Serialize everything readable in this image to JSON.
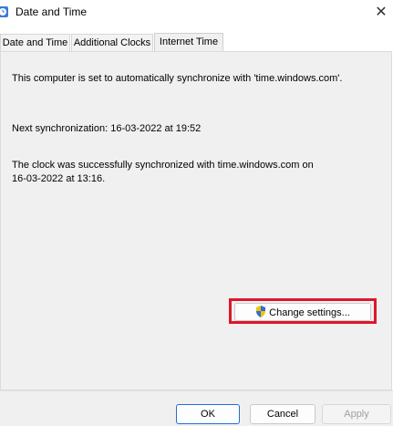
{
  "window": {
    "title": "Date and Time",
    "icon": "date-time-icon",
    "close_glyph": "✕"
  },
  "tabs": [
    {
      "label": "Date and Time",
      "selected": false
    },
    {
      "label": "Additional Clocks",
      "selected": false
    },
    {
      "label": "Internet Time",
      "selected": true
    }
  ],
  "internet_time": {
    "sync_server_text": "This computer is set to automatically synchronize with 'time.windows.com'.",
    "next_sync_text": "Next synchronization: 16-03-2022 at 19:52",
    "last_sync_line1": "The clock was successfully synchronized with time.windows.com on",
    "last_sync_line2": "16-03-2022 at 13:16.",
    "change_settings_label": "Change settings...",
    "change_settings_icon": "uac-shield-icon",
    "highlight_color": "#e0162b"
  },
  "footer": {
    "ok_label": "OK",
    "cancel_label": "Cancel",
    "apply_label": "Apply",
    "apply_enabled": false
  }
}
